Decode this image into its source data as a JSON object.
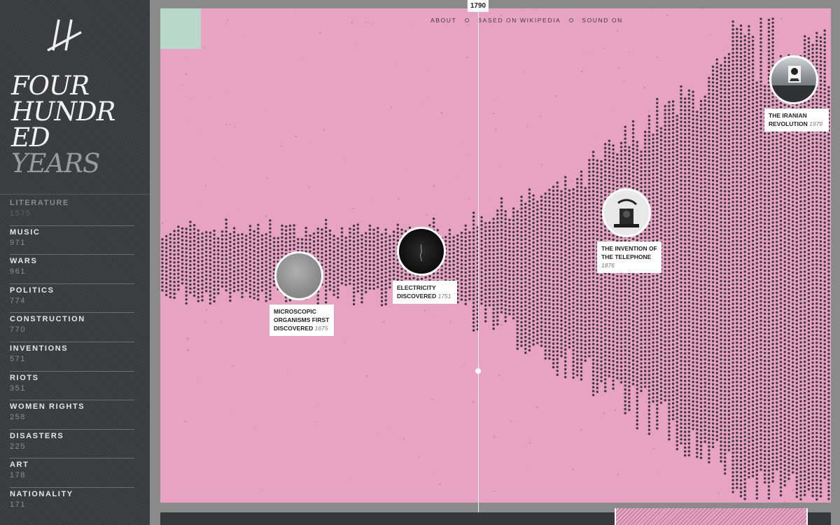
{
  "site": {
    "title_lines": [
      "FOUR",
      "HUNDR",
      "ED",
      "YEARS"
    ]
  },
  "nav": {
    "about": "ABOUT",
    "source": "BASED ON WIKIPEDIA",
    "sound": "SOUND ON"
  },
  "timeline": {
    "current_year": "1790"
  },
  "categories": [
    {
      "name": "LITERATURE",
      "count": "1575"
    },
    {
      "name": "MUSIC",
      "count": "971"
    },
    {
      "name": "WARS",
      "count": "961"
    },
    {
      "name": "POLITICS",
      "count": "774"
    },
    {
      "name": "CONSTRUCTION",
      "count": "770"
    },
    {
      "name": "INVENTIONS",
      "count": "571"
    },
    {
      "name": "RIOTS",
      "count": "351"
    },
    {
      "name": "WOMEN RIGHTS",
      "count": "258"
    },
    {
      "name": "DISASTERS",
      "count": "225"
    },
    {
      "name": "ART",
      "count": "178"
    },
    {
      "name": "NATIONALITY",
      "count": "171"
    }
  ],
  "events": [
    {
      "title": "MICROSCOPIC ORGANISMS FIRST DISCOVERED",
      "title_lines": [
        "MICROSCOPIC",
        "ORGANISMS FIRST",
        "DISCOVERED"
      ],
      "year": "1675"
    },
    {
      "title": "ELECTRICITY DISCOVERED",
      "title_lines": [
        "ELECTRICITY",
        "DISCOVERED"
      ],
      "year": "1751"
    },
    {
      "title": "THE INVENTION OF THE TELEPHONE",
      "title_lines": [
        "THE INVENTION OF",
        "THE TELEPHONE"
      ],
      "year": "1876"
    },
    {
      "title": "THE IRANIAN REVOLUTION",
      "title_lines": [
        "THE IRANIAN",
        "REVOLUTION"
      ],
      "year": "1979"
    }
  ],
  "colors": {
    "accent_pink": "#e8a2c2",
    "sidebar": "#3a3d40",
    "mint": "#b9d8cc",
    "dot": "#3e3940"
  },
  "icons": {
    "logo": "four-hundred-years-logo-icon"
  }
}
